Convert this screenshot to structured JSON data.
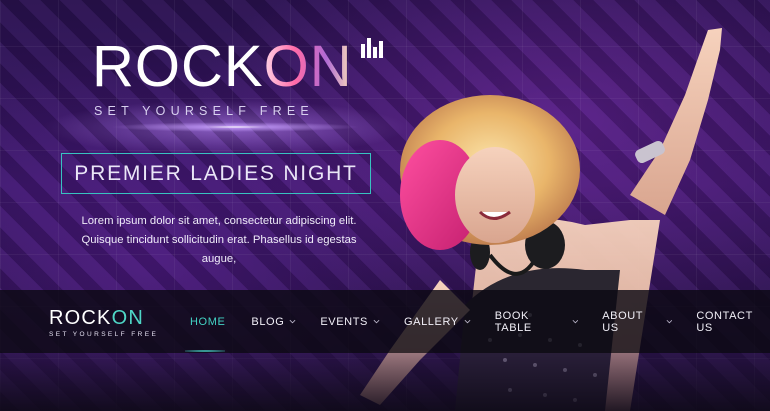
{
  "hero": {
    "logo_text": "ROCK",
    "logo_accent": "ON",
    "tagline": "SET YOURSELF FREE",
    "promo_title": "PREMIER LADIES NIGHT",
    "description": "Lorem ipsum dolor sit amet, consectetur adipiscing elit. Quisque tincidunt sollicitudin erat. Phasellus id egestas augue,"
  },
  "navbar": {
    "logo_text": "ROCK",
    "logo_accent": "ON",
    "tagline": "SET YOURSELF FREE",
    "items": [
      {
        "label": "HOME",
        "active": true,
        "dropdown": false
      },
      {
        "label": "BLOG",
        "active": false,
        "dropdown": true
      },
      {
        "label": "EVENTS",
        "active": false,
        "dropdown": true
      },
      {
        "label": "GALLERY",
        "active": false,
        "dropdown": true
      },
      {
        "label": "BOOK TABLE",
        "active": false,
        "dropdown": true
      },
      {
        "label": "ABOUT US",
        "active": false,
        "dropdown": true
      },
      {
        "label": "CONTACT US",
        "active": false,
        "dropdown": false
      }
    ]
  },
  "colors": {
    "accent": "#43d2c4",
    "promo_border": "#38c2c0",
    "background": "#2b1252"
  },
  "icons": {
    "logo_icon": "equalizer-icon",
    "dropdown_icon": "chevron-down-icon"
  }
}
